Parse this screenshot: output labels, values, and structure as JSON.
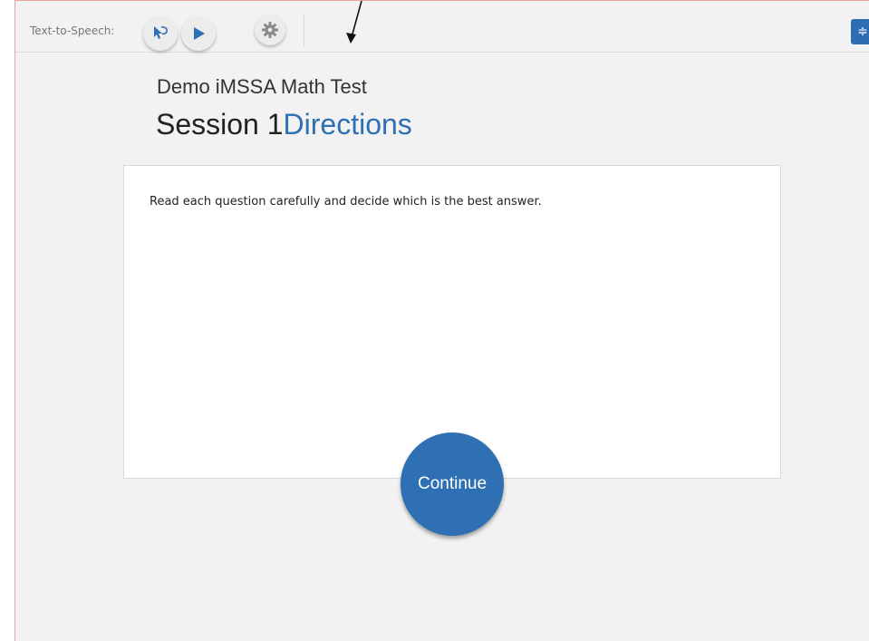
{
  "toolbar": {
    "tts_label": "Text-to-Speech:",
    "icons": {
      "select": "speech-select-icon",
      "play": "play-icon",
      "settings": "gear-icon",
      "menu": "menu-icon"
    }
  },
  "header": {
    "test_title": "Demo iMSSA Math Test",
    "session_label": "Session 1",
    "section_label": "Directions"
  },
  "card": {
    "instructions": "Read each question carefully and decide which is the best answer."
  },
  "actions": {
    "continue_label": "Continue"
  },
  "colors": {
    "accent": "#2f6fb3",
    "background": "#f2f2f2"
  }
}
